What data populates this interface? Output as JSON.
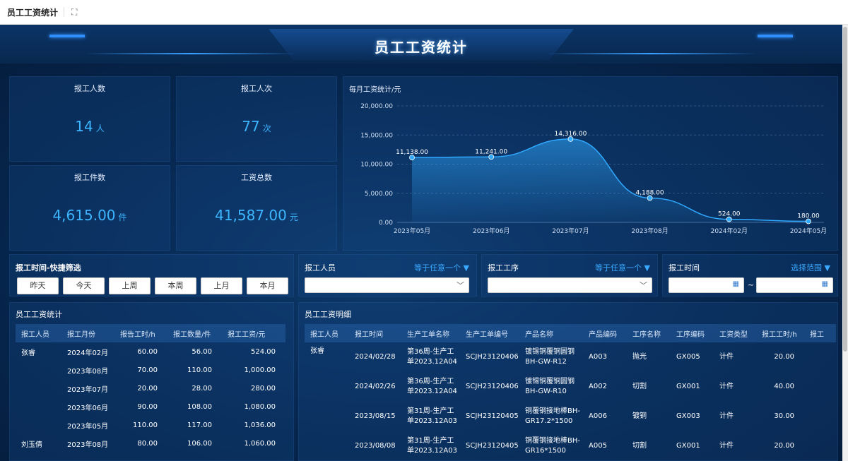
{
  "tab": {
    "title": "员工工资统计"
  },
  "header": {
    "title": "员工工资统计"
  },
  "kpis": [
    {
      "label": "报工人数",
      "value": "14",
      "unit": "人"
    },
    {
      "label": "报工人次",
      "value": "77",
      "unit": "次"
    },
    {
      "label": "报工件数",
      "value": "4,615.00",
      "unit": "件"
    },
    {
      "label": "工资总数",
      "value": "41,587.00",
      "unit": "元"
    }
  ],
  "chart_data": {
    "type": "area",
    "title": "每月工资统计/元",
    "categories": [
      "2023年05月",
      "2023年06月",
      "2023年07月",
      "2023年08月",
      "2024年02月",
      "2024年05月"
    ],
    "values": [
      11138,
      11241,
      14316,
      4188,
      524,
      180
    ],
    "value_labels": [
      "11,138.00",
      "11,241.00",
      "14,316.00",
      "4,188.00",
      "524.00",
      "180.00"
    ],
    "y_ticks": [
      "0.00",
      "5,000.00",
      "10,000.00",
      "15,000.00",
      "20,000.00"
    ],
    "ylim": [
      0,
      20000
    ],
    "grid": true,
    "color": "#2fa8ff"
  },
  "filters": {
    "quick_title": "报工时间-快捷筛选",
    "quick_buttons": [
      "昨天",
      "今天",
      "上周",
      "本周",
      "上月",
      "本月"
    ],
    "staff_label": "报工人员",
    "staff_op": "等于任意一个",
    "process_label": "报工工序",
    "process_op": "等于任意一个",
    "time_label": "报工时间",
    "time_op": "选择范围"
  },
  "summary_table": {
    "title": "员工工资统计",
    "columns": [
      "报工人员",
      "报工月份",
      "报告工时/h",
      "报工数量/件",
      "报工工资/元"
    ],
    "rows": [
      [
        "张睿",
        "2024年02月",
        "60.00",
        "56.00",
        "524.00"
      ],
      [
        "",
        "2023年08月",
        "70.00",
        "110.00",
        "1,000.00"
      ],
      [
        "",
        "2023年07月",
        "20.00",
        "28.00",
        "280.00"
      ],
      [
        "",
        "2023年06月",
        "90.00",
        "108.00",
        "1,080.00"
      ],
      [
        "",
        "2023年05月",
        "110.00",
        "117.00",
        "1,036.00"
      ],
      [
        "刘玉倩",
        "2023年08月",
        "80.00",
        "106.00",
        "1,060.00"
      ]
    ]
  },
  "detail_table": {
    "title": "员工工资明细",
    "columns": [
      "报工人员",
      "报工时间",
      "生产工单名称",
      "生产工单编号",
      "产品名称",
      "产品编码",
      "工序名称",
      "工序编码",
      "工资类型",
      "报工工时/h",
      "报工"
    ],
    "rows": [
      [
        "张睿",
        "2024/02/28",
        "第36周-生产工单2023.12A04",
        "SCJH23120406",
        "镀锡铜覆铜圆钢BH-GW-R12",
        "A003",
        "抛光",
        "GX005",
        "计件",
        "20.00"
      ],
      [
        "",
        "2024/02/26",
        "第36周-生产工单2023.12A04",
        "SCJH23120406",
        "镀锡铜覆铜圆钢BH-GW-R10",
        "A002",
        "切割",
        "GX001",
        "计件",
        "40.00"
      ],
      [
        "",
        "2023/08/15",
        "第31周-生产工单2023.12A03",
        "SCJH23120405",
        "铜覆钢接地棒BH-GR17.2*1500",
        "A006",
        "镀铜",
        "GX003",
        "计件",
        "30.00"
      ],
      [
        "",
        "2023/08/08",
        "第31周-生产工单2023.12A03",
        "SCJH23120405",
        "铜覆钢接地棒BH-GR16*1500",
        "A005",
        "切割",
        "GX001",
        "计件",
        "20.00"
      ]
    ]
  }
}
